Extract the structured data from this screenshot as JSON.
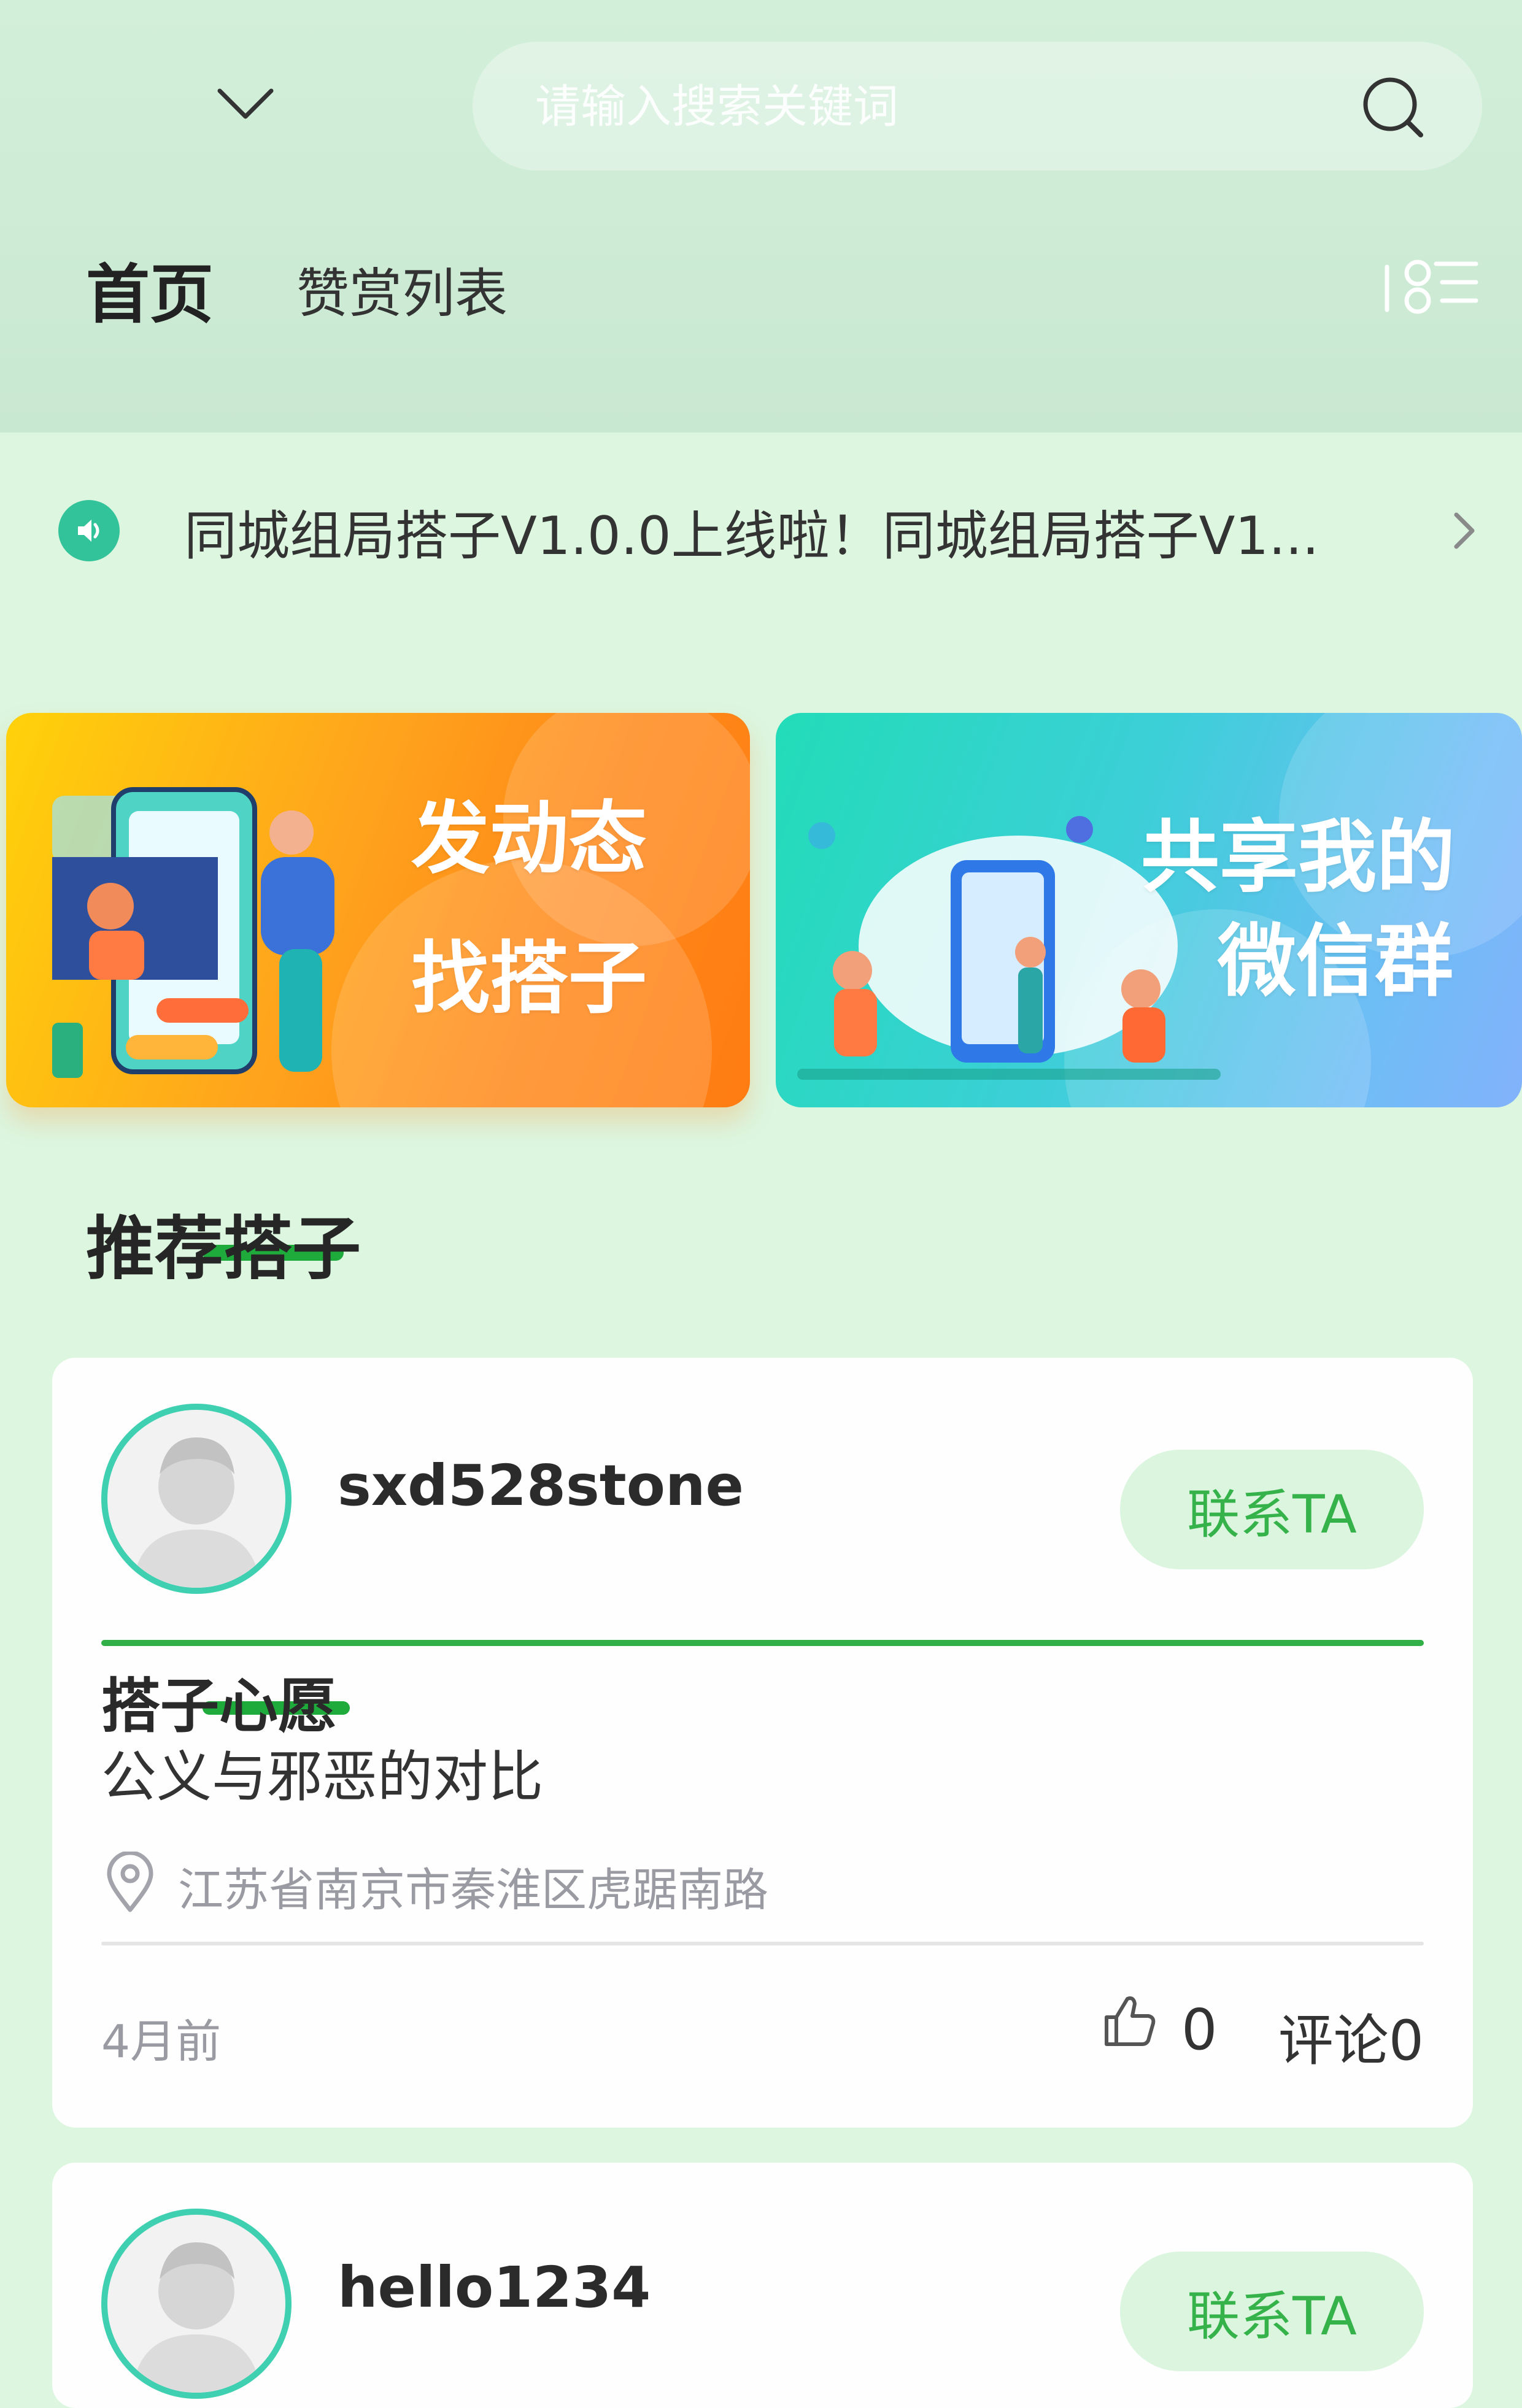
{
  "search": {
    "placeholder": "请输入搜索关键词"
  },
  "tabs": {
    "home": "首页",
    "reward_list": "赞赏列表"
  },
  "notice": {
    "text": "同城组局搭子V1.0.0上线啦！同城组局搭子V1..."
  },
  "banners": {
    "left": {
      "line1": "发动态",
      "line2": "找搭子"
    },
    "right": {
      "line1": "共享我的",
      "line2": "微信群"
    }
  },
  "section": {
    "title": "推荐搭子"
  },
  "posts": [
    {
      "username": "sxd528stone",
      "contact_label": "联系TA",
      "wish_title": "搭子心愿",
      "wish_text": "公义与邪恶的对比",
      "location": "江苏省南京市秦淮区虎踞南路",
      "time": "4月前",
      "likes": "0",
      "comments": "评论0"
    },
    {
      "username": "hello1234",
      "contact_label": "联系TA"
    }
  ],
  "colors": {
    "accent_green": "#1faa3c",
    "avatar_ring": "#3ed0b0",
    "contact_bg": "#dbf5df",
    "contact_text": "#35b24a",
    "notice_icon": "#32c39a"
  }
}
